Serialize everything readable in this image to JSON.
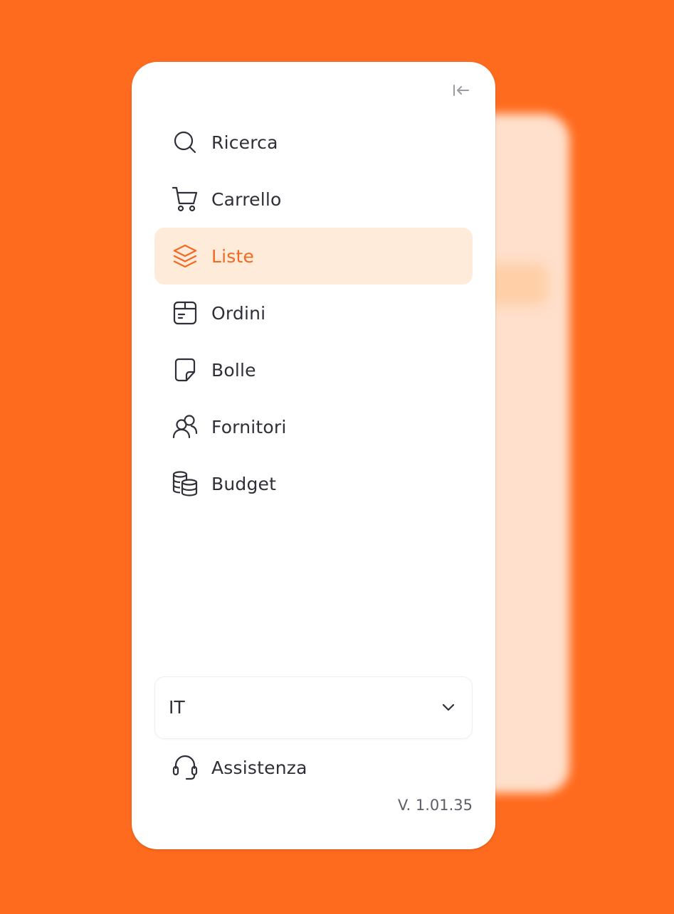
{
  "sidebar": {
    "collapse_icon": "collapse-left-icon",
    "items": [
      {
        "label": "Ricerca",
        "icon": "search-icon",
        "active": false
      },
      {
        "label": "Carrello",
        "icon": "cart-icon",
        "active": false
      },
      {
        "label": "Liste",
        "icon": "layers-icon",
        "active": true
      },
      {
        "label": "Ordini",
        "icon": "box-icon",
        "active": false
      },
      {
        "label": "Bolle",
        "icon": "note-icon",
        "active": false
      },
      {
        "label": "Fornitori",
        "icon": "users-icon",
        "active": false
      },
      {
        "label": "Budget",
        "icon": "coins-icon",
        "active": false
      }
    ],
    "language": {
      "value": "IT",
      "icon": "chevron-down-icon"
    },
    "support": {
      "label": "Assistenza",
      "icon": "headset-icon"
    },
    "version": "V. 1.01.35"
  },
  "colors": {
    "background": "#FF6B1E",
    "accent": "#F26A22",
    "active_bg": "#FFEBD9",
    "text": "#2F2F3A",
    "muted": "#5E5E6A"
  }
}
